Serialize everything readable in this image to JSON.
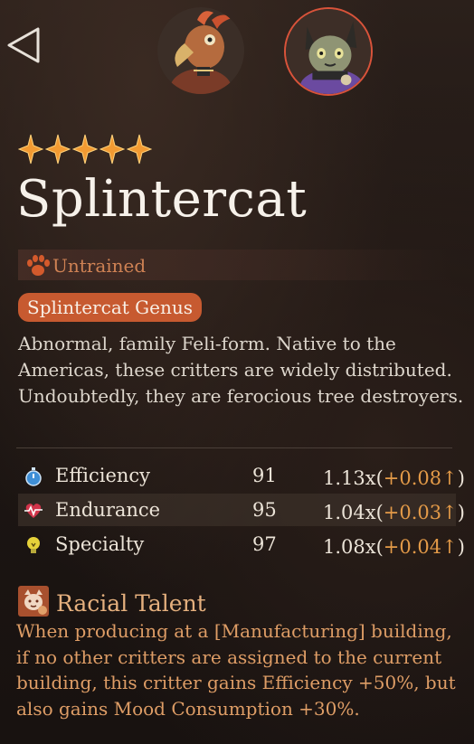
{
  "nav": {
    "back_icon": "back-arrow-icon"
  },
  "portraits": [
    {
      "icon": "bird-critter-portrait",
      "selected": false
    },
    {
      "icon": "splintercat-portrait",
      "selected": true
    }
  ],
  "critter": {
    "stars": 5,
    "name": "Splintercat",
    "status": "Untrained",
    "genus": "Splintercat Genus",
    "description": "Abnormal, family Feli-form. Native to the Americas, these critters are widely distributed. Undoubtedly, they are ferocious tree destroyers."
  },
  "stats": [
    {
      "icon": "stopwatch-icon",
      "name": "Efficiency",
      "value": "91",
      "mult": "1.13x(",
      "bonus": "+0.08↑",
      "close": ")"
    },
    {
      "icon": "heartbeat-icon",
      "name": "Endurance",
      "value": "95",
      "mult": "1.04x(",
      "bonus": "+0.03↑",
      "close": ")"
    },
    {
      "icon": "lightbulb-icon",
      "name": "Specialty",
      "value": "97",
      "mult": "1.08x(",
      "bonus": "+0.04↑",
      "close": ")"
    }
  ],
  "talent": {
    "icon": "cat-face-icon",
    "title": "Racial Talent",
    "description": "When producing at a [Manufacturing] building, if no other critters are assigned to the current building, this critter gains Efficiency +50%, but also gains Mood Consumption +30%."
  },
  "colors": {
    "accent": "#c75a30",
    "status_text": "#cf8254",
    "bonus": "#e39a48",
    "talent_text": "#de9d66",
    "selected_ring": "#d9533a"
  }
}
